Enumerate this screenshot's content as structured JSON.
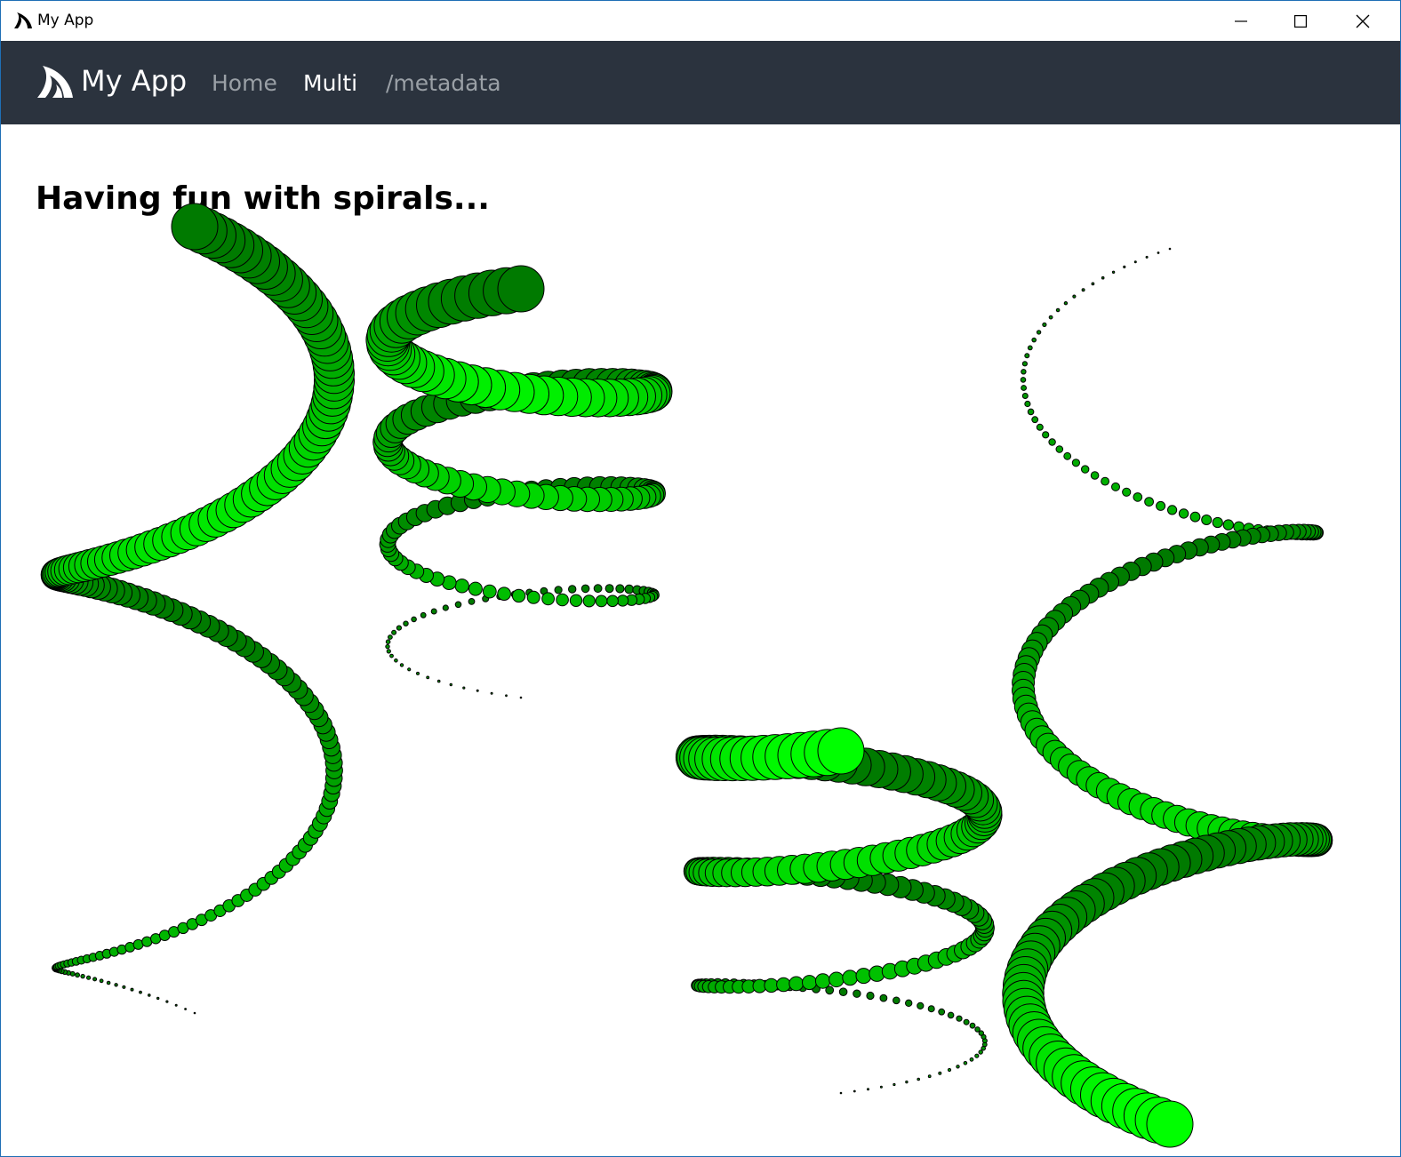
{
  "window": {
    "title": "My App",
    "icon": "shark-fin-icon",
    "controls": [
      "minimize-icon",
      "maximize-icon",
      "close-icon"
    ]
  },
  "navbar": {
    "brand": "My App",
    "brand_icon": "shark-fin-icon",
    "links": [
      {
        "label": "Home",
        "active": false
      },
      {
        "label": "Multi",
        "active": true
      },
      {
        "label": "/metadata",
        "active": false
      }
    ],
    "background": "#2b333e"
  },
  "main": {
    "heading": "Having fun with spirals...",
    "spiral_colors": {
      "bright": "#00ff00",
      "dark": "#004d00"
    },
    "spiral_count": 4
  }
}
